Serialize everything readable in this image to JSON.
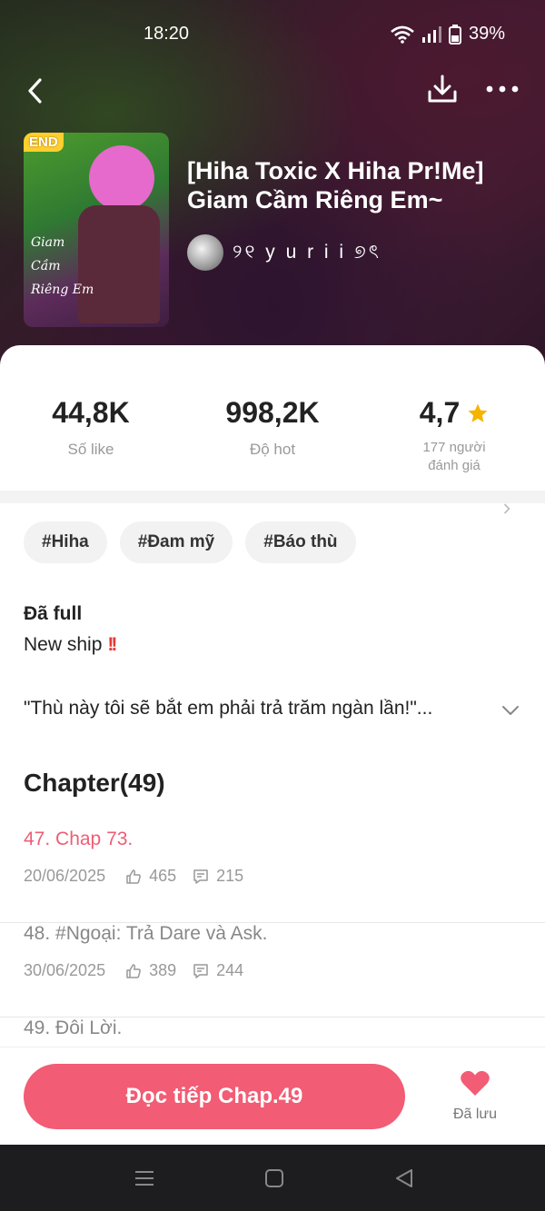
{
  "status_bar": {
    "time": "18:20",
    "battery": "39%"
  },
  "story": {
    "title": "[Hiha Toxic X Hiha Pr!Me] Giam Cầm Riêng Em~",
    "author": "୨୧ y u r i i ୭ৎ",
    "cover_badge": "END",
    "cover_text": "Giam Cầm Riêng Em"
  },
  "stats": {
    "likes": {
      "value": "44,8K",
      "label": "Số like"
    },
    "hot": {
      "value": "998,2K",
      "label": "Độ hot"
    },
    "rating": {
      "value": "4,7",
      "label_line1": "177 người",
      "label_line2": "đánh giá"
    }
  },
  "tags": [
    "#Hiha",
    "#Đam mỹ",
    "#Báo thù"
  ],
  "status_label": "Đã full",
  "description": "New ship",
  "description_marks": "!!",
  "summary": "\"Thù này tôi sẽ bắt em phải trả trăm ngàn lần!\"...",
  "chapter_header": "Chapter(49)",
  "chapters": [
    {
      "title": "47. Chap 73.",
      "date": "20/06/2025",
      "likes": "465",
      "comments": "215"
    },
    {
      "title": "48. #Ngoại: Trả Dare và Ask.",
      "date": "30/06/2025",
      "likes": "389",
      "comments": "244"
    },
    {
      "title": "49. Đôi Lời."
    }
  ],
  "read_button": "Đọc tiếp Chap.49",
  "saved_label": "Đã lưu",
  "colors": {
    "accent": "#f25c74",
    "star": "#f5b400",
    "current_chapter": "#ec5f75"
  }
}
